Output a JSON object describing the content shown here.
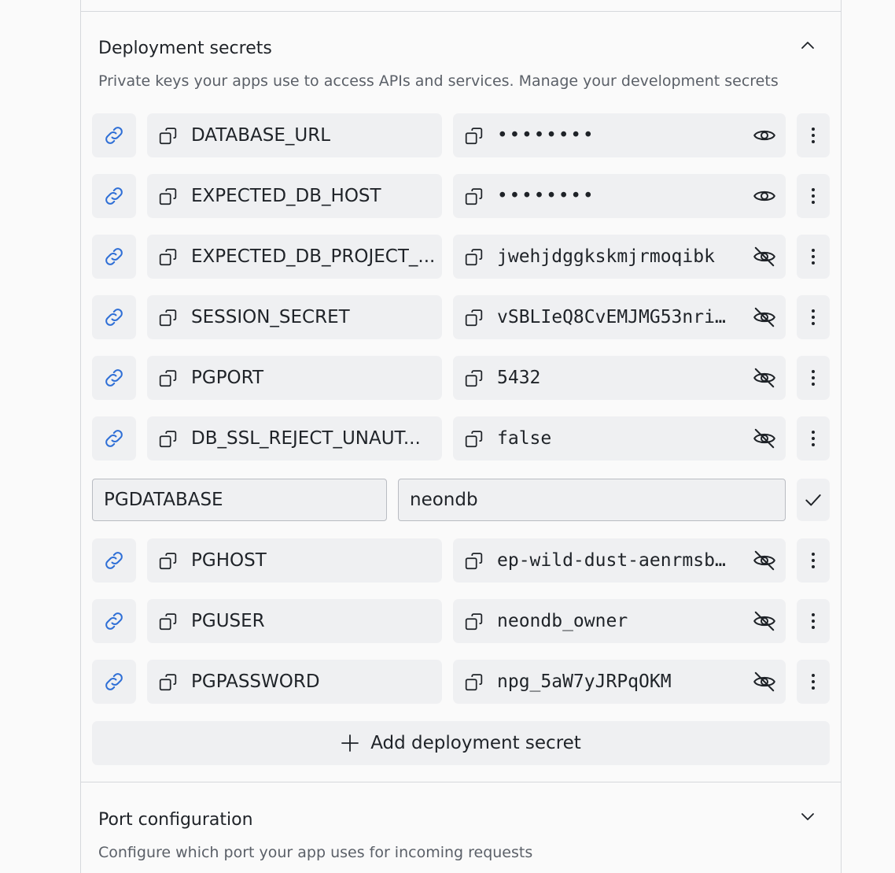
{
  "deployment_secrets": {
    "title": "Deployment secrets",
    "description": "Private keys your apps use to access APIs and services. Manage your development secrets",
    "secrets_before_edit": [
      {
        "key": "DATABASE_URL",
        "value": "••••••••",
        "hidden": true
      },
      {
        "key": "EXPECTED_DB_HOST",
        "value": "••••••••",
        "hidden": true
      },
      {
        "key": "EXPECTED_DB_PROJECT_...",
        "value": "jwehjdggkskmjrmoqibk",
        "hidden": false
      },
      {
        "key": "SESSION_SECRET",
        "value": "vSBLIeQ8CvEMJMG53nri…",
        "hidden": false
      },
      {
        "key": "PGPORT",
        "value": "5432",
        "hidden": false
      },
      {
        "key": "DB_SSL_REJECT_UNAUT...",
        "value": "false",
        "hidden": false
      }
    ],
    "editing": {
      "key": "PGDATABASE",
      "value": "neondb"
    },
    "secrets_after_edit": [
      {
        "key": "PGHOST",
        "value": "ep-wild-dust-aenrmsb…",
        "hidden": false
      },
      {
        "key": "PGUSER",
        "value": "neondb_owner",
        "hidden": false
      },
      {
        "key": "PGPASSWORD",
        "value": "npg_5aW7yJRPqOKM",
        "hidden": false
      }
    ],
    "add_label": "Add deployment secret"
  },
  "port_configuration": {
    "title": "Port configuration",
    "description": "Configure which port your app uses for incoming requests"
  },
  "colors": {
    "background": "#fafafa",
    "pill": "#eff0f2",
    "link_icon": "#2f6fd6",
    "text": "#1f2328",
    "muted": "#5b6068",
    "border": "#d6d8dc"
  }
}
